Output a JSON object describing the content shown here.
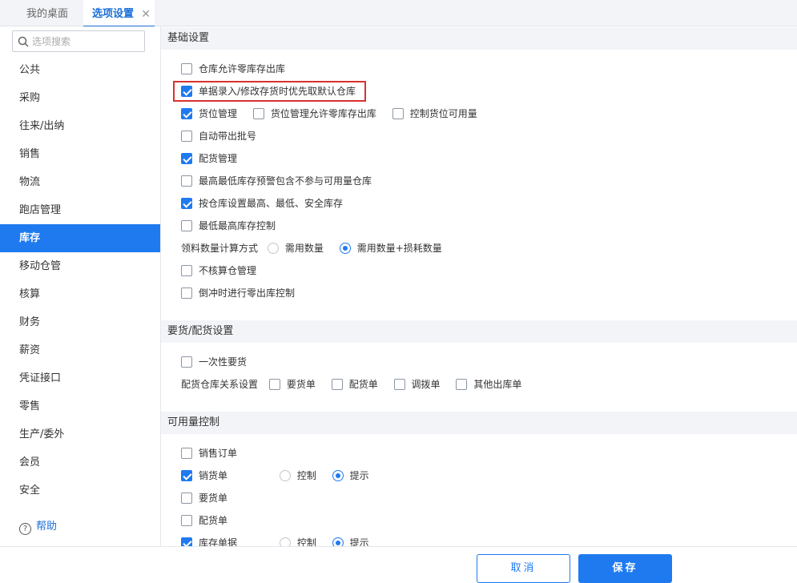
{
  "tabs": {
    "desktop": "我的桌面",
    "options": "选项设置",
    "close": "✕"
  },
  "sidebar": {
    "search_placeholder": "选项搜索",
    "items": [
      "公共",
      "采购",
      "往来/出纳",
      "销售",
      "物流",
      "跑店管理",
      "库存",
      "移动仓管",
      "核算",
      "财务",
      "薪资",
      "凭证接口",
      "零售",
      "生产/委外",
      "会员",
      "安全"
    ],
    "active": "库存",
    "help": "帮助"
  },
  "sections": {
    "basic": {
      "title": "基础设置",
      "opt1": "仓库允许零库存出库",
      "opt2": "单据录入/修改存货时优先取默认仓库",
      "opt3": "货位管理",
      "opt3b": "货位管理允许零库存出库",
      "opt3c": "控制货位可用量",
      "opt4": "自动带出批号",
      "opt5": "配货管理",
      "opt6": "最高最低库存预警包含不参与可用量仓库",
      "opt7": "按仓库设置最高、最低、安全库存",
      "opt8": "最低最高库存控制",
      "calc_label": "领料数量计算方式",
      "calc_opt1": "需用数量",
      "calc_opt2": "需用数量+损耗数量",
      "opt9": "不核算仓管理",
      "opt10": "倒冲时进行零出库控制"
    },
    "demand": {
      "title": "要货/配货设置",
      "opt1": "一次性要货",
      "rel_label": "配货仓库关系设置",
      "rel1": "要货单",
      "rel2": "配货单",
      "rel3": "调拨单",
      "rel4": "其他出库单"
    },
    "avail": {
      "title": "可用量控制",
      "opt1": "销售订单",
      "opt2": "销货单",
      "ctrl": "控制",
      "hint": "提示",
      "opt3": "要货单",
      "opt4": "配货单",
      "opt5": "库存单据"
    }
  },
  "footer": {
    "cancel": "取消",
    "save": "保存"
  }
}
